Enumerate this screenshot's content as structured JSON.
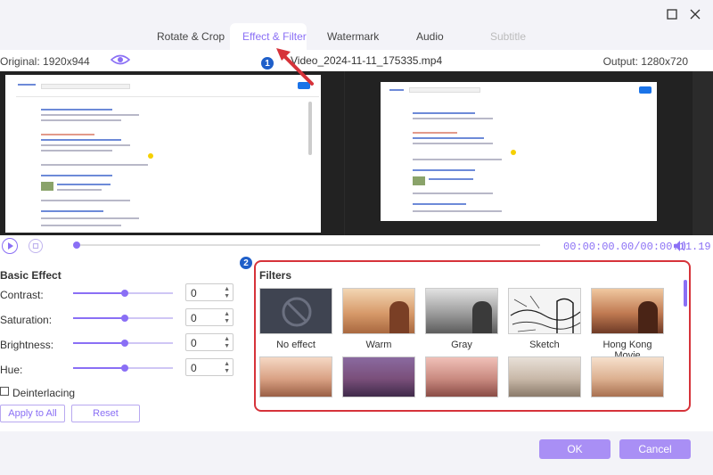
{
  "tabs": [
    {
      "label": "Rotate & Crop"
    },
    {
      "label": "Effect & Filter"
    },
    {
      "label": "Watermark"
    },
    {
      "label": "Audio"
    },
    {
      "label": "Subtitle"
    }
  ],
  "info": {
    "original": "Original: 1920x944",
    "filename": "Video_2024-11-11_175335.mp4",
    "output": "Output: 1280x720"
  },
  "player": {
    "time": "00:00:00.00/00:00:11.19"
  },
  "basic_effect": {
    "title": "Basic Effect",
    "sliders": [
      {
        "label": "Contrast:",
        "value": "0",
        "level": 0.5
      },
      {
        "label": "Saturation:",
        "value": "0",
        "level": 0.5
      },
      {
        "label": "Brightness:",
        "value": "0",
        "level": 0.5
      },
      {
        "label": "Hue:",
        "value": "0",
        "level": 0.5
      }
    ],
    "deinterlacing": "Deinterlacing",
    "apply_all": "Apply to All",
    "reset": "Reset"
  },
  "filters": {
    "title": "Filters",
    "items": [
      {
        "label": "No effect"
      },
      {
        "label": "Warm"
      },
      {
        "label": "Gray"
      },
      {
        "label": "Sketch"
      },
      {
        "label": "Hong Kong Movie"
      }
    ]
  },
  "annotations": [
    "1",
    "2"
  ],
  "footer": {
    "ok": "OK",
    "cancel": "Cancel"
  },
  "colors": {
    "accent": "#8a6ff5",
    "highlight": "#d6333a",
    "badge": "#1f5fc9"
  }
}
